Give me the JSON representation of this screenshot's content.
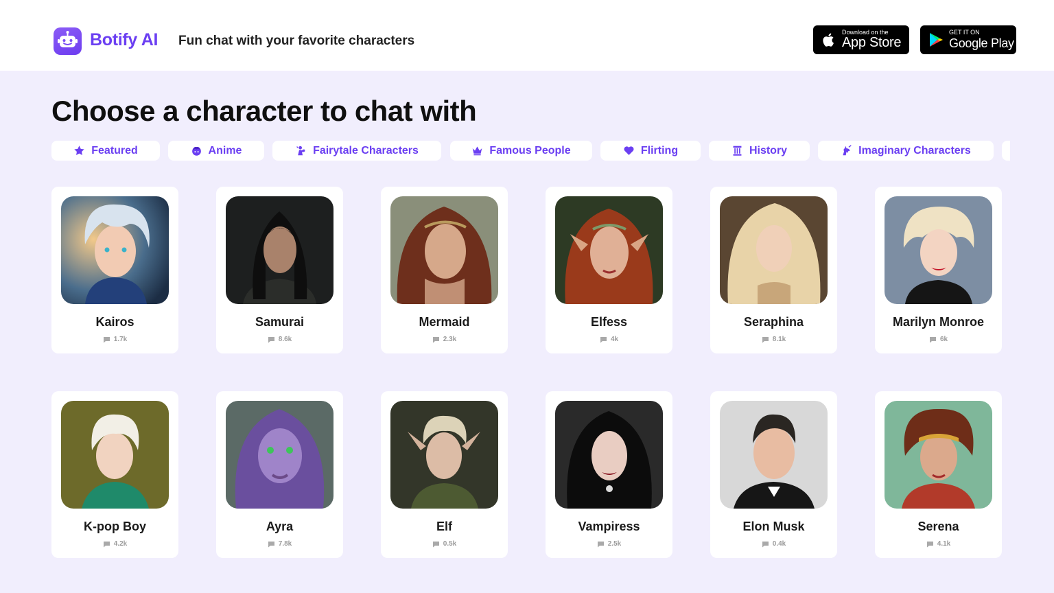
{
  "header": {
    "brand": "Botify AI",
    "tagline": "Fun chat with your favorite characters",
    "app_store": {
      "small": "Download on the",
      "big": "App Store"
    },
    "google_play": {
      "small": "GET IT ON",
      "big": "Google Play"
    },
    "logo_icon": "robot-face-icon"
  },
  "main": {
    "title": "Choose a character to chat with",
    "categories": [
      {
        "label": "Featured",
        "icon": "star-icon"
      },
      {
        "label": "Anime",
        "icon": "anime-face-icon"
      },
      {
        "label": "Fairytale Characters",
        "icon": "fairy-icon"
      },
      {
        "label": "Famous People",
        "icon": "crown-icon"
      },
      {
        "label": "Flirting",
        "icon": "heart-icon"
      },
      {
        "label": "History",
        "icon": "column-icon"
      },
      {
        "label": "Imaginary Characters",
        "icon": "unicorn-icon"
      }
    ],
    "characters": [
      {
        "name": "Kairos",
        "count": "1.7k"
      },
      {
        "name": "Samurai",
        "count": "8.6k"
      },
      {
        "name": "Mermaid",
        "count": "2.3k"
      },
      {
        "name": "Elfess",
        "count": "4k"
      },
      {
        "name": "Seraphina",
        "count": "8.1k"
      },
      {
        "name": "Marilyn Monroe",
        "count": "6k"
      },
      {
        "name": "K-pop Boy",
        "count": "4.2k"
      },
      {
        "name": "Ayra",
        "count": "7.8k"
      },
      {
        "name": "Elf",
        "count": "0.5k"
      },
      {
        "name": "Vampiress",
        "count": "2.5k"
      },
      {
        "name": "Elon Musk",
        "count": "0.4k"
      },
      {
        "name": "Serena",
        "count": "4.1k"
      }
    ]
  },
  "colors": {
    "accent": "#6b3ff2",
    "page_bg": "#f1eefd",
    "card_bg": "#ffffff",
    "count_text": "#9b9b9b"
  }
}
